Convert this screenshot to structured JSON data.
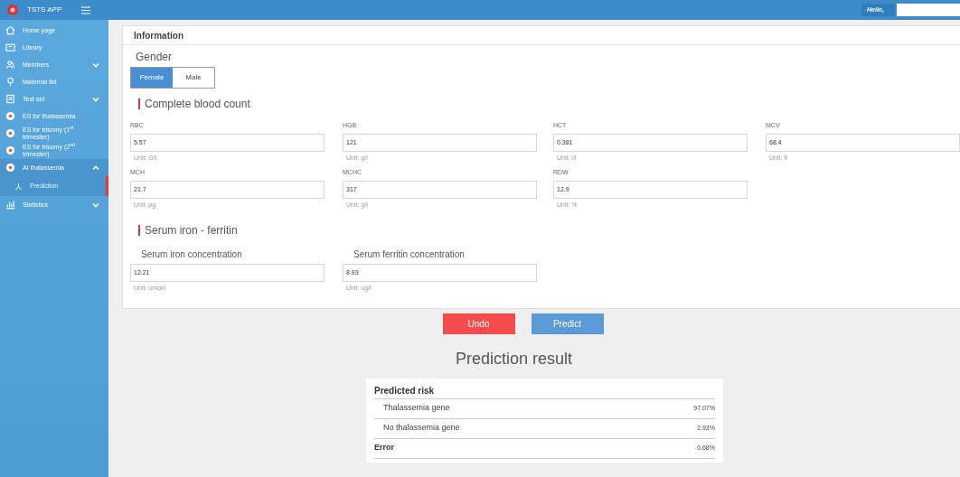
{
  "app": {
    "title": "TSTS APP"
  },
  "header": {
    "greeting": "Hello,"
  },
  "sidebar": {
    "items": [
      {
        "label": "Home page",
        "selected": false
      },
      {
        "label": "Library",
        "selected": false
      },
      {
        "label": "Members",
        "selected": false,
        "expanded": false
      },
      {
        "label": "Maternal list",
        "selected": false
      },
      {
        "label": "Test set",
        "selected": false,
        "expanded": false
      },
      {
        "label": "ES for thalassemia",
        "selected": false
      },
      {
        "label": "ES for trisomy (1$^{st}$ trimester)",
        "selected": false
      },
      {
        "label": "ES for trisomy (2$^{nd}$ trimester)",
        "selected": false
      },
      {
        "label": "AI thalassemia",
        "selected": false,
        "expanded": true,
        "children": [
          {
            "label": "Prediction",
            "selected": true
          }
        ]
      },
      {
        "label": "Statistics",
        "selected": false,
        "expanded": false
      }
    ]
  },
  "card": {
    "title": "Information"
  },
  "gender": {
    "label": "Gender",
    "options": [
      {
        "label": "Female",
        "selected": true
      },
      {
        "label": "Male",
        "selected": false
      }
    ]
  },
  "sections": [
    {
      "title": "Complete blood count",
      "kind": "grid",
      "fields": [
        {
          "label": "RBC",
          "value": "5.57",
          "unit": "Unit: G/l"
        },
        {
          "label": "HGB",
          "value": "121",
          "unit": "Unit: g/l"
        },
        {
          "label": "HCT",
          "value": "0.381",
          "unit": "Unit: l/l"
        },
        {
          "label": "MCV",
          "value": "68.4",
          "unit": "Unit: fl"
        },
        {
          "label": "MCH",
          "value": "21.7",
          "unit": "Unit: pg"
        },
        {
          "label": "MCHC",
          "value": "317",
          "unit": "Unit: g/l"
        },
        {
          "label": "RDW",
          "value": "12.9",
          "unit": "Unit: %"
        }
      ]
    },
    {
      "title": "Serum iron  - ferritin",
      "kind": "wide",
      "fields": [
        {
          "label": "Serum iron concentration",
          "value": "12.21",
          "unit": "Unit: umol/l"
        },
        {
          "label": "Serum ferritin concentration",
          "value": "8.93",
          "unit": "Unit: ug/l"
        }
      ]
    }
  ],
  "buttons": [
    {
      "label": "Undo",
      "kind": "danger"
    },
    {
      "label": "Predict",
      "kind": "primary"
    }
  ],
  "result": {
    "title": "Prediction result",
    "table_title": "Predicted risk",
    "rows": [
      {
        "label": "Thalassemia gene",
        "value": "97.07%",
        "kind": "item"
      },
      {
        "label": "No thalassemia gene",
        "value": "2.93%",
        "kind": "item"
      },
      {
        "label": "Error",
        "value": "0.68%",
        "kind": "total"
      }
    ]
  }
}
